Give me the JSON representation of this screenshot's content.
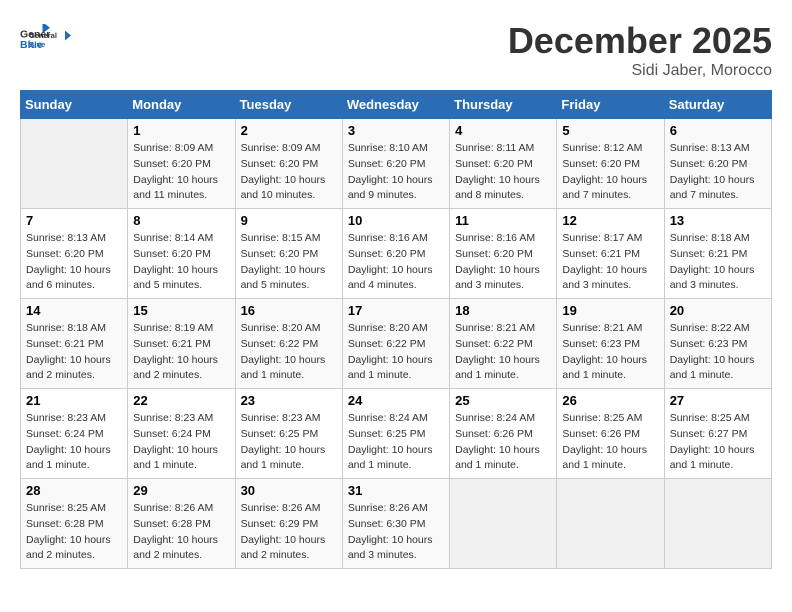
{
  "header": {
    "logo_line1": "General",
    "logo_line2": "Blue",
    "month": "December 2025",
    "location": "Sidi Jaber, Morocco"
  },
  "weekdays": [
    "Sunday",
    "Monday",
    "Tuesday",
    "Wednesday",
    "Thursday",
    "Friday",
    "Saturday"
  ],
  "weeks": [
    [
      {
        "day": "",
        "sunrise": "",
        "sunset": "",
        "daylight": "",
        "empty": true
      },
      {
        "day": "1",
        "sunrise": "Sunrise: 8:09 AM",
        "sunset": "Sunset: 6:20 PM",
        "daylight": "Daylight: 10 hours and 11 minutes."
      },
      {
        "day": "2",
        "sunrise": "Sunrise: 8:09 AM",
        "sunset": "Sunset: 6:20 PM",
        "daylight": "Daylight: 10 hours and 10 minutes."
      },
      {
        "day": "3",
        "sunrise": "Sunrise: 8:10 AM",
        "sunset": "Sunset: 6:20 PM",
        "daylight": "Daylight: 10 hours and 9 minutes."
      },
      {
        "day": "4",
        "sunrise": "Sunrise: 8:11 AM",
        "sunset": "Sunset: 6:20 PM",
        "daylight": "Daylight: 10 hours and 8 minutes."
      },
      {
        "day": "5",
        "sunrise": "Sunrise: 8:12 AM",
        "sunset": "Sunset: 6:20 PM",
        "daylight": "Daylight: 10 hours and 7 minutes."
      },
      {
        "day": "6",
        "sunrise": "Sunrise: 8:13 AM",
        "sunset": "Sunset: 6:20 PM",
        "daylight": "Daylight: 10 hours and 7 minutes."
      }
    ],
    [
      {
        "day": "7",
        "sunrise": "Sunrise: 8:13 AM",
        "sunset": "Sunset: 6:20 PM",
        "daylight": "Daylight: 10 hours and 6 minutes."
      },
      {
        "day": "8",
        "sunrise": "Sunrise: 8:14 AM",
        "sunset": "Sunset: 6:20 PM",
        "daylight": "Daylight: 10 hours and 5 minutes."
      },
      {
        "day": "9",
        "sunrise": "Sunrise: 8:15 AM",
        "sunset": "Sunset: 6:20 PM",
        "daylight": "Daylight: 10 hours and 5 minutes."
      },
      {
        "day": "10",
        "sunrise": "Sunrise: 8:16 AM",
        "sunset": "Sunset: 6:20 PM",
        "daylight": "Daylight: 10 hours and 4 minutes."
      },
      {
        "day": "11",
        "sunrise": "Sunrise: 8:16 AM",
        "sunset": "Sunset: 6:20 PM",
        "daylight": "Daylight: 10 hours and 3 minutes."
      },
      {
        "day": "12",
        "sunrise": "Sunrise: 8:17 AM",
        "sunset": "Sunset: 6:21 PM",
        "daylight": "Daylight: 10 hours and 3 minutes."
      },
      {
        "day": "13",
        "sunrise": "Sunrise: 8:18 AM",
        "sunset": "Sunset: 6:21 PM",
        "daylight": "Daylight: 10 hours and 3 minutes."
      }
    ],
    [
      {
        "day": "14",
        "sunrise": "Sunrise: 8:18 AM",
        "sunset": "Sunset: 6:21 PM",
        "daylight": "Daylight: 10 hours and 2 minutes."
      },
      {
        "day": "15",
        "sunrise": "Sunrise: 8:19 AM",
        "sunset": "Sunset: 6:21 PM",
        "daylight": "Daylight: 10 hours and 2 minutes."
      },
      {
        "day": "16",
        "sunrise": "Sunrise: 8:20 AM",
        "sunset": "Sunset: 6:22 PM",
        "daylight": "Daylight: 10 hours and 1 minute."
      },
      {
        "day": "17",
        "sunrise": "Sunrise: 8:20 AM",
        "sunset": "Sunset: 6:22 PM",
        "daylight": "Daylight: 10 hours and 1 minute."
      },
      {
        "day": "18",
        "sunrise": "Sunrise: 8:21 AM",
        "sunset": "Sunset: 6:22 PM",
        "daylight": "Daylight: 10 hours and 1 minute."
      },
      {
        "day": "19",
        "sunrise": "Sunrise: 8:21 AM",
        "sunset": "Sunset: 6:23 PM",
        "daylight": "Daylight: 10 hours and 1 minute."
      },
      {
        "day": "20",
        "sunrise": "Sunrise: 8:22 AM",
        "sunset": "Sunset: 6:23 PM",
        "daylight": "Daylight: 10 hours and 1 minute."
      }
    ],
    [
      {
        "day": "21",
        "sunrise": "Sunrise: 8:23 AM",
        "sunset": "Sunset: 6:24 PM",
        "daylight": "Daylight: 10 hours and 1 minute."
      },
      {
        "day": "22",
        "sunrise": "Sunrise: 8:23 AM",
        "sunset": "Sunset: 6:24 PM",
        "daylight": "Daylight: 10 hours and 1 minute."
      },
      {
        "day": "23",
        "sunrise": "Sunrise: 8:23 AM",
        "sunset": "Sunset: 6:25 PM",
        "daylight": "Daylight: 10 hours and 1 minute."
      },
      {
        "day": "24",
        "sunrise": "Sunrise: 8:24 AM",
        "sunset": "Sunset: 6:25 PM",
        "daylight": "Daylight: 10 hours and 1 minute."
      },
      {
        "day": "25",
        "sunrise": "Sunrise: 8:24 AM",
        "sunset": "Sunset: 6:26 PM",
        "daylight": "Daylight: 10 hours and 1 minute."
      },
      {
        "day": "26",
        "sunrise": "Sunrise: 8:25 AM",
        "sunset": "Sunset: 6:26 PM",
        "daylight": "Daylight: 10 hours and 1 minute."
      },
      {
        "day": "27",
        "sunrise": "Sunrise: 8:25 AM",
        "sunset": "Sunset: 6:27 PM",
        "daylight": "Daylight: 10 hours and 1 minute."
      }
    ],
    [
      {
        "day": "28",
        "sunrise": "Sunrise: 8:25 AM",
        "sunset": "Sunset: 6:28 PM",
        "daylight": "Daylight: 10 hours and 2 minutes."
      },
      {
        "day": "29",
        "sunrise": "Sunrise: 8:26 AM",
        "sunset": "Sunset: 6:28 PM",
        "daylight": "Daylight: 10 hours and 2 minutes."
      },
      {
        "day": "30",
        "sunrise": "Sunrise: 8:26 AM",
        "sunset": "Sunset: 6:29 PM",
        "daylight": "Daylight: 10 hours and 2 minutes."
      },
      {
        "day": "31",
        "sunrise": "Sunrise: 8:26 AM",
        "sunset": "Sunset: 6:30 PM",
        "daylight": "Daylight: 10 hours and 3 minutes."
      },
      {
        "day": "",
        "sunrise": "",
        "sunset": "",
        "daylight": "",
        "empty": true
      },
      {
        "day": "",
        "sunrise": "",
        "sunset": "",
        "daylight": "",
        "empty": true
      },
      {
        "day": "",
        "sunrise": "",
        "sunset": "",
        "daylight": "",
        "empty": true
      }
    ]
  ]
}
